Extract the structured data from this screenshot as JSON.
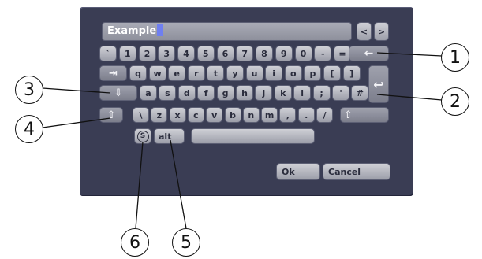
{
  "text_field": {
    "value": "Example"
  },
  "nav": {
    "left": "<",
    "right": ">"
  },
  "row1": [
    "`",
    "1",
    "2",
    "3",
    "4",
    "5",
    "6",
    "7",
    "8",
    "9",
    "0",
    "-",
    "="
  ],
  "row2": [
    "q",
    "w",
    "e",
    "r",
    "t",
    "y",
    "u",
    "i",
    "o",
    "p",
    "[",
    "]"
  ],
  "row3": [
    "a",
    "s",
    "d",
    "f",
    "g",
    "h",
    "j",
    "k",
    "l",
    ";",
    "'",
    "#"
  ],
  "row4": [
    "\\",
    "z",
    "x",
    "c",
    "v",
    "b",
    "n",
    "m",
    ",",
    ".",
    "/"
  ],
  "keys": {
    "backspace": "←",
    "tab": "⇥",
    "enter": "↩",
    "caps_lock": "⇩",
    "shift": "⇧",
    "right_shift": "⇧",
    "special": "S",
    "alt": "alt",
    "space": ""
  },
  "buttons": {
    "ok": "Ok",
    "cancel": "Cancel"
  },
  "callouts": {
    "c1": "1",
    "c2": "2",
    "c3": "3",
    "c4": "4",
    "c5": "5",
    "c6": "6"
  }
}
